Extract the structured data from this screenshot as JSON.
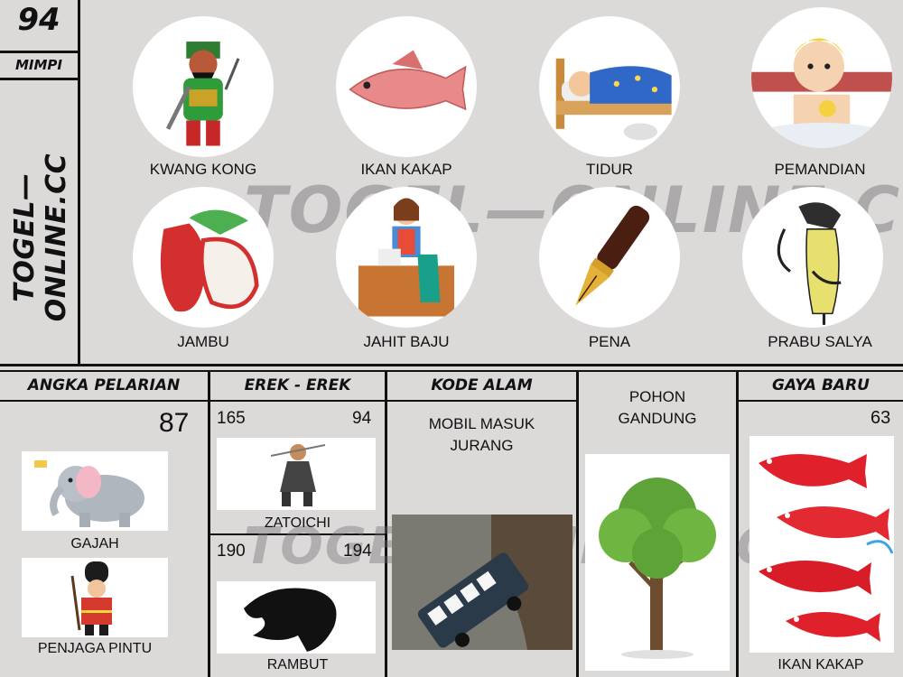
{
  "number": "94",
  "category": "MIMPI",
  "site": "TOGEL—ONLINE.CC",
  "watermark": "TOGEL—ONLINE.CC",
  "dreams": [
    {
      "label": "KWANG KONG",
      "icon": "warrior-icon"
    },
    {
      "label": "IKAN KAKAP",
      "icon": "fish-icon"
    },
    {
      "label": "TIDUR",
      "icon": "sleeping-boy-icon"
    },
    {
      "label": "PEMANDIAN",
      "icon": "bathing-boy-icon"
    },
    {
      "label": "JAMBU",
      "icon": "rose-apple-icon"
    },
    {
      "label": "JAHIT BAJU",
      "icon": "tailor-icon"
    },
    {
      "label": "PENA",
      "icon": "fountain-pen-icon"
    },
    {
      "label": "PRABU SALYA",
      "icon": "wayang-puppet-icon"
    }
  ],
  "sections": {
    "angka_pelarian": {
      "title": "ANGKA PELARIAN",
      "number": "87",
      "items": [
        {
          "label": "GAJAH",
          "icon": "elephant-icon"
        },
        {
          "label": "PENJAGA PINTU",
          "icon": "guard-icon"
        }
      ]
    },
    "erek_erek": {
      "title": "EREK - EREK",
      "items": [
        {
          "left": "165",
          "right": "94",
          "label": "ZATOICHI",
          "icon": "swordsman-icon"
        },
        {
          "left": "190",
          "right": "194",
          "label": "RAMBUT",
          "icon": "hair-silhouette-icon"
        }
      ]
    },
    "kode_alam": {
      "title": "KODE ALAM",
      "text_line1": "MOBIL MASUK",
      "text_line2": "JURANG",
      "icon": "falling-bus-icon"
    },
    "pohon": {
      "text_line1": "POHON",
      "text_line2": "GANDUNG",
      "icon": "tree-icon"
    },
    "gaya_baru": {
      "title": "GAYA BARU",
      "number": "63",
      "label": "IKAN KAKAP",
      "icon": "red-fish-icon"
    }
  }
}
